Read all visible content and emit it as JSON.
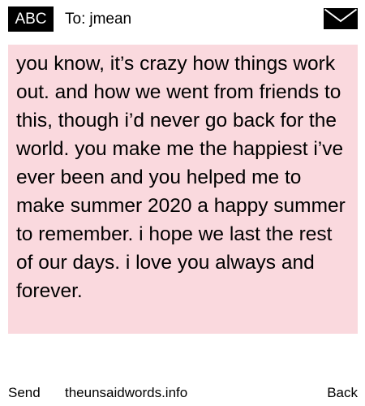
{
  "header": {
    "badge_label": "ABC",
    "to_label": "To:",
    "recipient": "jmean",
    "mail_icon": "envelope-icon"
  },
  "message": {
    "body": "you know, it’s crazy how things work out. and how we went from friends to this, though i’d never go back for the world. you make me the happiest i’ve ever been and you helped me to make summer 2020 a happy summer to remember. i hope we last the rest of our days. i love you always and forever.",
    "background_color": "#fad9de"
  },
  "footer": {
    "send_label": "Send",
    "site_label": "theunsaidwords.info",
    "back_label": "Back"
  }
}
